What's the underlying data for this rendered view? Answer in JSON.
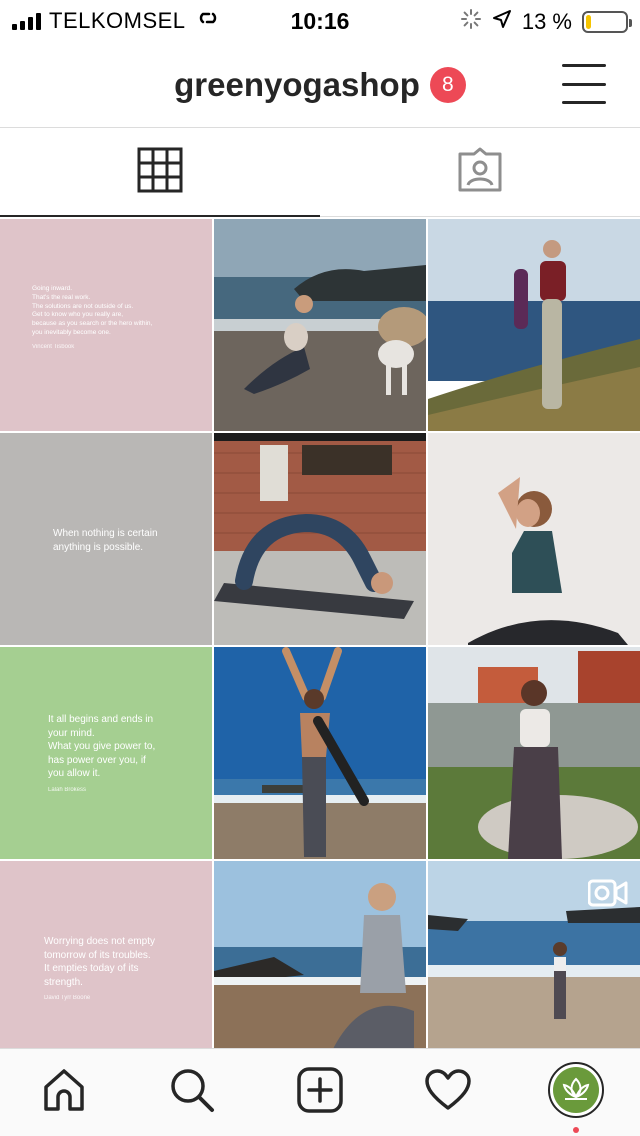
{
  "status_bar": {
    "carrier": "TELKOMSEL",
    "time": "10:16",
    "battery_percent": "13 %",
    "battery_level": 0.13
  },
  "header": {
    "username": "greenyogashop",
    "notification_count": "8",
    "menu_icon": "hamburger-menu-icon"
  },
  "tabs": [
    {
      "icon": "grid-icon",
      "active": true
    },
    {
      "icon": "tagged-icon",
      "active": false
    }
  ],
  "quotes": {
    "q1": {
      "text": "Going inward.\nThat's the real work.\nThe solutions are not outside of us.\nGet to know who you really are,\nbecause as you search or the hero within,\nyou inevitably become one.",
      "author": "Vincent Tisbook",
      "bg": "#dfc4c9"
    },
    "q2": {
      "text": "When nothing is certain\nanything is possible.",
      "bg": "#b9b7b5"
    },
    "q3": {
      "text": "It all begins and ends in\nyour mind.\nWhat you give power to,\nhas power over you, if\nyou allow it.",
      "author": "Lalah Brokess",
      "bg": "#a5cf91"
    },
    "q4": {
      "text": "Worrying does not empty\ntomorrow of its troubles.\nIt empties today of its\nstrength.",
      "author": "David Tyrr Boone",
      "bg": "#dfc4c9"
    }
  },
  "colors": {
    "badge": "#ed4956",
    "profile_ring": "#6a9a3b",
    "text": "#262626"
  },
  "bottom_nav": [
    "home-icon",
    "search-icon",
    "new-post-icon",
    "activity-heart-icon",
    "profile-avatar"
  ]
}
